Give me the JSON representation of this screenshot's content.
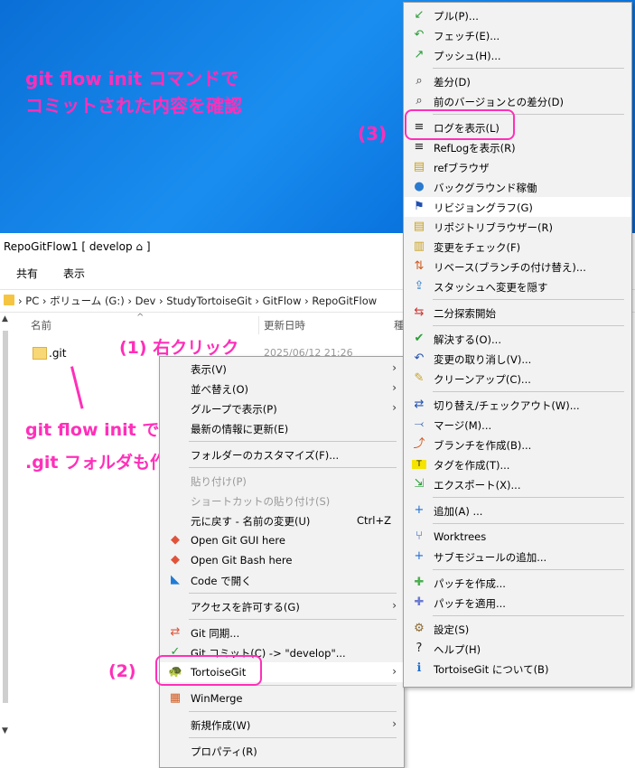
{
  "desktop": {
    "note_line1": "git flow init コマンドで",
    "note_line2": "コミットされた内容を確認",
    "label3": "(3)"
  },
  "explorer": {
    "title": "RepoGitFlow1 [ develop ⌂ ]",
    "ribbon": [
      "共有",
      "表示"
    ],
    "breadcrumb": "›   PC   ›  ボリューム (G:)  ›  Dev  ›  StudyTortoiseGit  ›  GitFlow  ›  RepoGitFlow",
    "columns": {
      "name": "名前",
      "date": "更新日時",
      "type": "種"
    },
    "file": {
      "name": ".git",
      "date": "2025/06/12 21:26"
    },
    "label1": "(1) 右クリック",
    "note_git_line1": "git flow init で",
    "note_git_line2": ".git フォルダも作成されました。",
    "label2": "(2)"
  },
  "context_menu": {
    "items": [
      {
        "label": "表示(V)",
        "arrow": true
      },
      {
        "label": "並べ替え(O)",
        "arrow": true
      },
      {
        "label": "グループで表示(P)",
        "arrow": true
      },
      {
        "label": "最新の情報に更新(E)"
      },
      {
        "sep": true
      },
      {
        "label": "フォルダーのカスタマイズ(F)..."
      },
      {
        "sep": true
      },
      {
        "label": "貼り付け(P)",
        "disabled": true
      },
      {
        "label": "ショートカットの貼り付け(S)",
        "disabled": true
      },
      {
        "label": "元に戻す - 名前の変更(U)",
        "shortcut": "Ctrl+Z"
      },
      {
        "label": "Open Git GUI here",
        "icon": "git-gui-icon"
      },
      {
        "label": "Open Git Bash here",
        "icon": "git-bash-icon"
      },
      {
        "label": "Code で開く",
        "icon": "vscode-icon"
      },
      {
        "sep": true
      },
      {
        "label": "アクセスを許可する(G)",
        "arrow": true
      },
      {
        "sep": true
      },
      {
        "label": "Git 同期...",
        "icon": "git-sync-icon"
      },
      {
        "label": "Git コミット(C) -> \"develop\"...",
        "icon": "git-commit-icon"
      },
      {
        "label": "TortoiseGit",
        "icon": "tortoisegit-icon",
        "arrow": true,
        "highlight": true
      },
      {
        "sep": true
      },
      {
        "label": "WinMerge",
        "icon": "winmerge-icon"
      },
      {
        "sep": true
      },
      {
        "label": "新規作成(W)",
        "arrow": true
      },
      {
        "sep": true
      },
      {
        "label": "プロパティ(R)"
      }
    ]
  },
  "tortoise_menu": {
    "items": [
      {
        "label": "プル(P)...",
        "icon": "pull-icon"
      },
      {
        "label": "フェッチ(E)...",
        "icon": "fetch-icon"
      },
      {
        "label": "プッシュ(H)...",
        "icon": "push-icon"
      },
      {
        "sep": true
      },
      {
        "label": "差分(D)",
        "icon": "diff-icon"
      },
      {
        "label": "前のバージョンとの差分(D)",
        "icon": "diff-prev-icon"
      },
      {
        "sep": true
      },
      {
        "label": "ログを表示(L)",
        "icon": "log-icon"
      },
      {
        "label": "RefLogを表示(R)",
        "icon": "reflog-icon"
      },
      {
        "label": "refブラウザ",
        "icon": "ref-browser-icon"
      },
      {
        "label": "バックグラウンド稼働",
        "icon": "globe-icon"
      },
      {
        "label": "リビジョングラフ(G)",
        "icon": "revision-graph-icon",
        "highlight": true
      },
      {
        "label": "リポジトリブラウザー(R)",
        "icon": "repo-browser-icon"
      },
      {
        "label": "変更をチェック(F)",
        "icon": "check-changes-icon"
      },
      {
        "label": "リベース(ブランチの付け替え)...",
        "icon": "rebase-icon"
      },
      {
        "label": "スタッシュへ変更を隠す",
        "icon": "stash-icon"
      },
      {
        "sep": true
      },
      {
        "label": "二分探索開始",
        "icon": "bisect-icon"
      },
      {
        "sep": true
      },
      {
        "label": "解決する(O)...",
        "icon": "resolve-icon"
      },
      {
        "label": "変更の取り消し(V)...",
        "icon": "revert-icon"
      },
      {
        "label": "クリーンアップ(C)...",
        "icon": "cleanup-icon"
      },
      {
        "sep": true
      },
      {
        "label": "切り替え/チェックアウト(W)...",
        "icon": "switch-icon"
      },
      {
        "label": "マージ(M)...",
        "icon": "merge-icon"
      },
      {
        "label": "ブランチを作成(B)...",
        "icon": "branch-icon"
      },
      {
        "label": "タグを作成(T)...",
        "icon": "tag-icon"
      },
      {
        "label": "エクスポート(X)...",
        "icon": "export-icon"
      },
      {
        "sep": true
      },
      {
        "label": "追加(A) ...",
        "icon": "add-icon"
      },
      {
        "sep": true
      },
      {
        "label": "Worktrees",
        "icon": "worktrees-icon"
      },
      {
        "label": "サブモジュールの追加...",
        "icon": "submodule-icon"
      },
      {
        "sep": true
      },
      {
        "label": "パッチを作成...",
        "icon": "create-patch-icon"
      },
      {
        "label": "パッチを適用...",
        "icon": "apply-patch-icon"
      },
      {
        "sep": true
      },
      {
        "label": "設定(S)",
        "icon": "settings-icon"
      },
      {
        "label": "ヘルプ(H)",
        "icon": "help-icon"
      },
      {
        "label": "TortoiseGit について(B)",
        "icon": "about-icon"
      }
    ]
  },
  "colors": {
    "annotation": "#ff2fb9",
    "desktop": "#1a8ef0"
  }
}
